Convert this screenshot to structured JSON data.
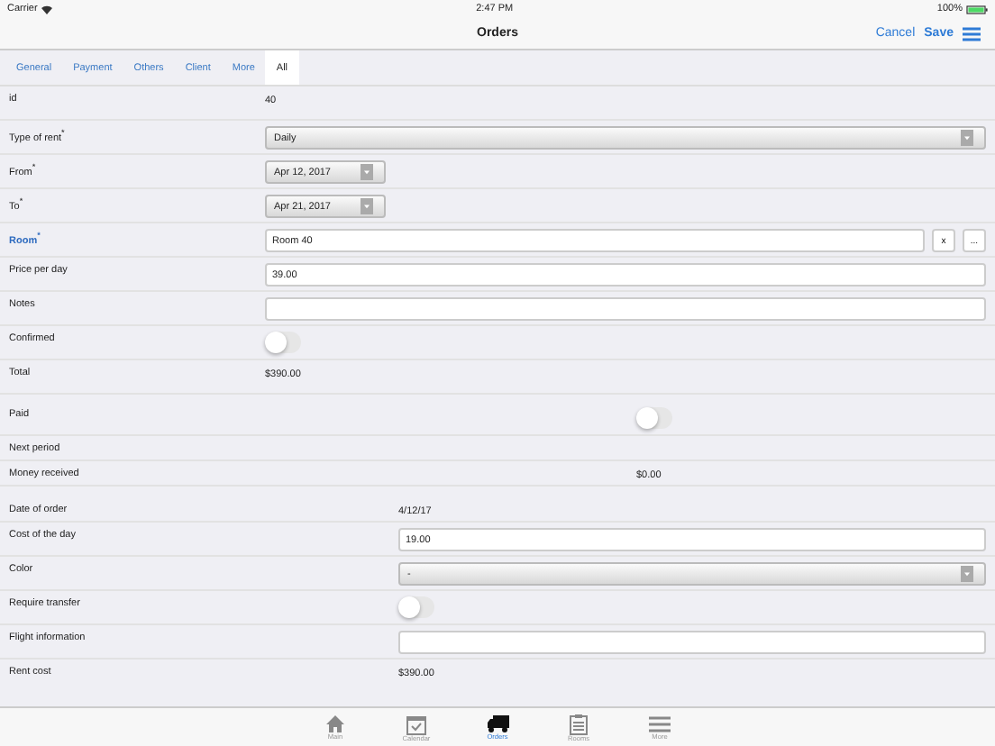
{
  "status_bar": {
    "carrier": "Carrier",
    "time": "2:47 PM",
    "battery": "100%"
  },
  "nav_bar": {
    "title": "Orders",
    "cancel": "Cancel",
    "save": "Save"
  },
  "tabs": [
    {
      "label": "General",
      "selected": false
    },
    {
      "label": "Payment",
      "selected": false
    },
    {
      "label": "Others",
      "selected": false
    },
    {
      "label": "Client",
      "selected": false
    },
    {
      "label": "More",
      "selected": false
    },
    {
      "label": "All",
      "selected": true
    }
  ],
  "sections": [
    {
      "rows": [
        {
          "kind": "text",
          "label": "id",
          "value": "40"
        },
        {
          "kind": "select",
          "label": "Type of rent$^{*}$",
          "value": "Daily"
        },
        {
          "kind": "date",
          "label": "From$^{*}$",
          "value": "Apr 12, 2017"
        },
        {
          "kind": "date",
          "label": "To$^{*}$",
          "value": "Apr 21, 2017"
        },
        {
          "kind": "lookup",
          "label": "Room$^{*}$",
          "value": "Room 40",
          "highlighted": true,
          "clear": "x",
          "browse": "..."
        },
        {
          "kind": "input",
          "label": "Price per day",
          "value": "39.00"
        },
        {
          "kind": "input",
          "label": "Notes"
        },
        {
          "kind": "toggle",
          "label": "Confirmed",
          "on": false
        },
        {
          "kind": "text",
          "label": "Total",
          "value": "$390.00"
        }
      ]
    },
    {
      "rows": [
        {
          "kind": "toggle",
          "label": "Paid",
          "on": false
        },
        {
          "kind": "text",
          "label": "Next period"
        },
        {
          "kind": "text",
          "label": "Money received",
          "value": "$0.00"
        }
      ]
    },
    {
      "rows": [
        {
          "kind": "text",
          "label": "Date of order",
          "value": "4/12/17"
        },
        {
          "kind": "input",
          "label": "Cost of the day",
          "value": "19.00"
        },
        {
          "kind": "select",
          "label": "Color",
          "value": "-"
        },
        {
          "kind": "toggle",
          "label": "Require transfer",
          "on": false
        },
        {
          "kind": "input",
          "label": "Flight information"
        },
        {
          "kind": "text",
          "label": "Rent cost",
          "value": "$390.00"
        }
      ]
    }
  ],
  "tab_bar": [
    {
      "label": "Main",
      "kind": "house",
      "selected": false
    },
    {
      "label": "Calendar",
      "kind": "calendar",
      "selected": false
    },
    {
      "label": "Orders",
      "kind": "truck",
      "selected": true
    },
    {
      "label": "Rooms",
      "kind": "clipboard",
      "selected": false
    },
    {
      "label": "More",
      "kind": "menu",
      "selected": false
    }
  ]
}
